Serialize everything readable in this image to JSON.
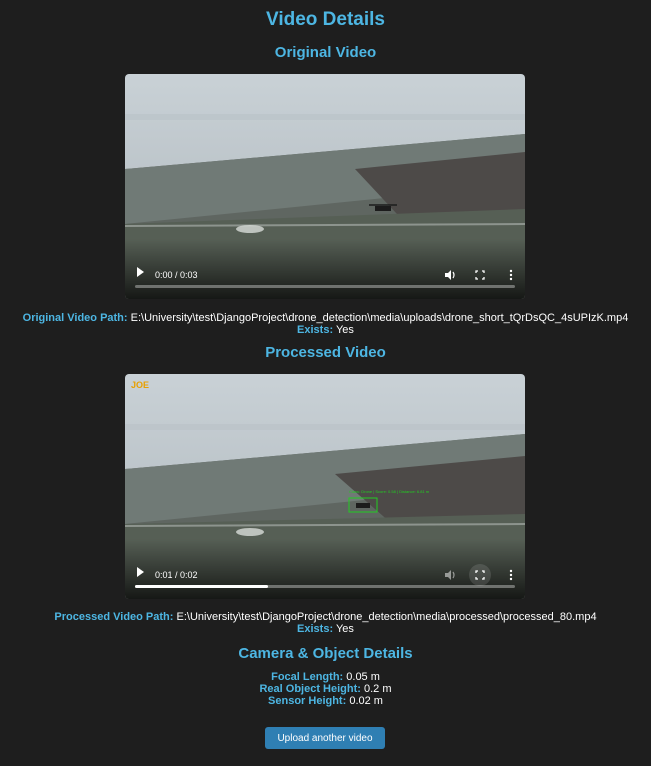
{
  "page": {
    "title": "Video Details"
  },
  "original": {
    "heading": "Original Video",
    "time": "0:00 / 0:03",
    "progress": 0,
    "path_label": "Original Video Path:",
    "path_value": "E:\\University\\test\\DjangoProject\\drone_detection\\media\\uploads\\drone_short_tQrDsQC_4sUPIzK.mp4",
    "exists_label": "Exists:",
    "exists_value": "Yes"
  },
  "processed": {
    "heading": "Processed Video",
    "time": "0:01 / 0:02",
    "progress": 0.35,
    "path_label": "Processed Video Path:",
    "path_value": "E:\\University\\test\\DjangoProject\\drone_detection\\media\\processed\\processed_80.mp4",
    "exists_label": "Exists:",
    "exists_value": "Yes",
    "watermark": "JOE",
    "overlay_text": "Class: Drone | Score: 0.58 | Distance: 6.81 m"
  },
  "camera": {
    "heading": "Camera & Object Details",
    "focal_label": "Focal Length:",
    "focal_value": "0.05 m",
    "real_label": "Real Object Height:",
    "real_value": "0.2 m",
    "sensor_label": "Sensor Height:",
    "sensor_value": "0.02 m"
  },
  "actions": {
    "upload_label": "Upload another video"
  },
  "colors": {
    "accent": "#4db6e3",
    "button": "#2f7fb3",
    "background": "#1e1e1e",
    "detection_box": "#22cc22"
  }
}
